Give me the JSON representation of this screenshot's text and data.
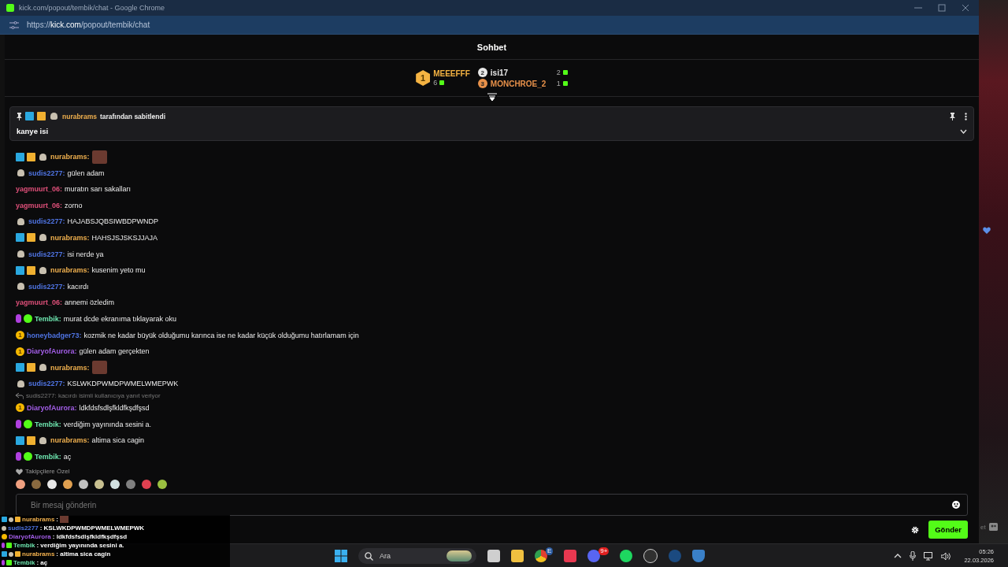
{
  "window": {
    "title": "kick.com/popout/tembik/chat - Google Chrome",
    "url_prefix": "https://",
    "url_host": "kick.com",
    "url_path": "/popout/tembik/chat"
  },
  "chat": {
    "title": "Sohbet",
    "leaderboard": [
      {
        "rank": "1",
        "name": "MEEEFFF",
        "count": "6",
        "color": "#f5b342"
      },
      {
        "rank": "2",
        "name": "isi17",
        "count": "2",
        "color": "#e8e8e8"
      },
      {
        "rank": "3",
        "name": "MONCHROE_2",
        "count": "1",
        "color": "#e8914a"
      }
    ],
    "pinned": {
      "badges": [
        {
          "kind": "moderator"
        },
        {
          "kind": "crown"
        },
        {
          "kind": "og"
        }
      ],
      "user": "nurabrams",
      "suffix": "tarafından sabitlendi",
      "text": "kanye isi"
    },
    "messages": [
      {
        "badges": [
          {
            "kind": "moderator"
          },
          {
            "kind": "crown"
          },
          {
            "kind": "og"
          }
        ],
        "user": "nurabrams:",
        "color": "#f0b04e",
        "emote": true
      },
      {
        "badges": [
          {
            "kind": "og"
          }
        ],
        "user": "sudis2277:",
        "color": "#4f74e3",
        "text": "gülen adam"
      },
      {
        "user": "yagmuurt_06:",
        "color": "#e0507a",
        "text": "muratın sarı sakalları"
      },
      {
        "user": "yagmuurt_06:",
        "color": "#e0507a",
        "text": "zorno"
      },
      {
        "badges": [
          {
            "kind": "og"
          }
        ],
        "user": "sudis2277:",
        "color": "#4f74e3",
        "text": "HAJABSJQBSIWBDPWNDP"
      },
      {
        "badges": [
          {
            "kind": "moderator"
          },
          {
            "kind": "crown"
          },
          {
            "kind": "og"
          }
        ],
        "user": "nurabrams:",
        "color": "#f0b04e",
        "text": "HAHSJSJSKSJJAJA"
      },
      {
        "badges": [
          {
            "kind": "og"
          }
        ],
        "user": "sudis2277:",
        "color": "#4f74e3",
        "text": "isi nerde ya"
      },
      {
        "badges": [
          {
            "kind": "moderator"
          },
          {
            "kind": "crown"
          },
          {
            "kind": "og"
          }
        ],
        "user": "nurabrams:",
        "color": "#f0b04e",
        "text": "kusenim yeto mu"
      },
      {
        "badges": [
          {
            "kind": "og"
          }
        ],
        "user": "sudis2277:",
        "color": "#4f74e3",
        "text": "kacırdı"
      },
      {
        "user": "yagmuurt_06:",
        "color": "#e0507a",
        "text": "annemi özledim"
      },
      {
        "badges": [
          {
            "kind": "broadcaster"
          },
          {
            "kind": "verified"
          }
        ],
        "user": "Tembik:",
        "color": "#6ee7b0",
        "text": "murat dcde ekranıma tıklayarak oku"
      },
      {
        "badges": [
          {
            "kind": "gifter",
            "label": "1"
          }
        ],
        "user": "honeybadger73:",
        "color": "#4f74e3",
        "text": "kozmik ne kadar büyük olduğumu karınca ise ne kadar küçük olduğumu hatırlamam için"
      },
      {
        "badges": [
          {
            "kind": "gifter",
            "label": "1"
          }
        ],
        "user": "DiaryofAurora:",
        "color": "#a35ee8",
        "text": "gülen adam gerçekten"
      },
      {
        "badges": [
          {
            "kind": "moderator"
          },
          {
            "kind": "crown"
          },
          {
            "kind": "og"
          }
        ],
        "user": "nurabrams:",
        "color": "#f0b04e",
        "emote": true
      },
      {
        "badges": [
          {
            "kind": "og"
          }
        ],
        "user": "sudis2277:",
        "color": "#4f74e3",
        "text": "KSLWKDPWMDPWMELWMEPWK"
      },
      {
        "badges": [
          {
            "kind": "gifter",
            "label": "1"
          }
        ],
        "user": "DiaryofAurora:",
        "color": "#a35ee8",
        "text": "ldkfdsfsdlşfkldfkşdfşsd",
        "reply": "sudis2277: kacırdı isimli kullanıcıya yanıt veriyor"
      },
      {
        "badges": [
          {
            "kind": "broadcaster"
          },
          {
            "kind": "verified"
          }
        ],
        "user": "Tembik:",
        "color": "#6ee7b0",
        "text": "verdiğim yayınında sesini a."
      },
      {
        "badges": [
          {
            "kind": "moderator"
          },
          {
            "kind": "crown"
          },
          {
            "kind": "og"
          }
        ],
        "user": "nurabrams:",
        "color": "#f0b04e",
        "text": "altima sica cagin"
      },
      {
        "badges": [
          {
            "kind": "broadcaster"
          },
          {
            "kind": "verified"
          }
        ],
        "user": "Tembik:",
        "color": "#6ee7b0",
        "text": "aç"
      }
    ],
    "followers_label": "Takipçilere Özel",
    "input": {
      "placeholder": "Bir mesaj gönderin"
    },
    "send_button": "Gönder"
  },
  "overlay": [
    {
      "badges": [
        {
          "kind": "moderator"
        },
        {
          "kind": "og"
        },
        {
          "kind": "crown"
        }
      ],
      "user": "nurabrams",
      "color": "#f0b04e",
      "text": ":",
      "emote": true
    },
    {
      "badges": [
        {
          "kind": "og"
        }
      ],
      "user": "sudis2277",
      "color": "#4f74e3",
      "text": ": KSLWKDPWMDPWMELWMEPWK"
    },
    {
      "badges": [
        {
          "kind": "gifter"
        }
      ],
      "user": "DiaryofAurora",
      "color": "#a35ee8",
      "text": ": ldkfdsfsdlşfkldfkşdfşsd"
    },
    {
      "badges": [
        {
          "kind": "broadcaster"
        },
        {
          "kind": "verified"
        }
      ],
      "user": "Tembik",
      "color": "#6ee7b0",
      "text": ": verdiğim yayınında sesini a."
    },
    {
      "badges": [
        {
          "kind": "moderator"
        },
        {
          "kind": "og"
        },
        {
          "kind": "crown"
        }
      ],
      "user": "nurabrams",
      "color": "#f0b04e",
      "text": ": altima sica cagin"
    },
    {
      "badges": [
        {
          "kind": "broadcaster"
        },
        {
          "kind": "verified"
        }
      ],
      "user": "Tembik",
      "color": "#6ee7b0",
      "text": ": aç"
    }
  ],
  "desktop_edge": {
    "text": "et"
  },
  "taskbar": {
    "search": "Ara",
    "chrome_profile": "E",
    "discord_badge": "9+",
    "time": "05:26",
    "date": "22.03.2026"
  }
}
